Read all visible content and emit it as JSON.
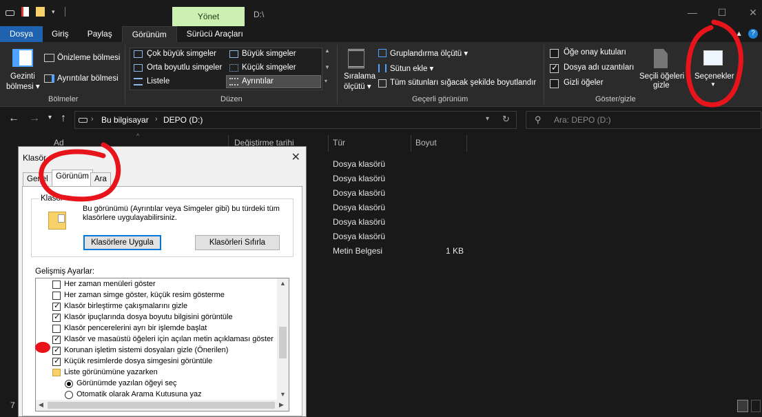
{
  "titlebar": {
    "context_tab": "Yönet",
    "window_title": "D:\\"
  },
  "ribbon_tabs": [
    "Dosya",
    "Giriş",
    "Paylaş",
    "Görünüm",
    "Sürücü Araçları"
  ],
  "ribbon": {
    "panes": {
      "navigation_pane": [
        "Gezinti",
        "bölmesi"
      ],
      "preview_pane": "Önizleme bölmesi",
      "details_pane": "Ayrıntılar bölmesi",
      "group": "Bölmeler"
    },
    "layout": {
      "items": [
        "Çok büyük simgeler",
        "Büyük simgeler",
        "Orta boyutlu simgeler",
        "Küçük simgeler",
        "Listele",
        "Ayrıntılar"
      ],
      "group": "Düzen"
    },
    "current_view": {
      "sort_by": [
        "Sıralama",
        "ölçütü"
      ],
      "group_by": "Gruplandırma ölçütü",
      "add_columns": "Sütun ekle",
      "size_columns": "Tüm sütunları sığacak şekilde boyutlandır",
      "group": "Geçerli görünüm"
    },
    "show_hide": {
      "item_checkboxes": {
        "label": "Öğe onay kutuları",
        "checked": false
      },
      "file_extensions": {
        "label": "Dosya adı uzantıları",
        "checked": true
      },
      "hidden_items": {
        "label": "Gizli öğeler",
        "checked": false
      },
      "hide_selected": [
        "Seçili öğeleri",
        "gizle"
      ],
      "options": "Seçenekler",
      "group": "Göster/gizle"
    }
  },
  "address": {
    "crumbs": [
      "Bu bilgisayar",
      "DEPO (D:)"
    ],
    "search_placeholder": "Ara: DEPO (D:)"
  },
  "filelist": {
    "columns": [
      "Ad",
      "Değiştirme tarihi",
      "Tür",
      "Boyut"
    ],
    "rows": [
      {
        "type": "Dosya klasörü",
        "size": ""
      },
      {
        "type": "Dosya klasörü",
        "size": ""
      },
      {
        "type": "Dosya klasörü",
        "size": ""
      },
      {
        "type": "Dosya klasörü",
        "size": ""
      },
      {
        "type": "Dosya klasörü",
        "size": ""
      },
      {
        "type": "Dosya klasörü",
        "size": ""
      },
      {
        "type": "Metin Belgesi",
        "size": "1 KB"
      }
    ]
  },
  "statusbar": {
    "count": "7"
  },
  "dialog": {
    "title": "Klasör",
    "tabs": [
      "Genel",
      "Görünüm",
      "Ara"
    ],
    "folder_views_label": "Klasör",
    "folder_views_desc": [
      "Bu görünümü (Ayrıntılar veya Simgeler gibi) bu türdeki tüm",
      "klasörlere uygulayabilirsiniz."
    ],
    "apply_button": "Klasörlere Uygula",
    "reset_button": "Klasörleri Sıfırla",
    "advanced_label": "Gelişmiş Ayarlar:",
    "settings": [
      {
        "label": "Her zaman menüleri göster",
        "kind": "check",
        "checked": false
      },
      {
        "label": "Her zaman simge göster, küçük resim gösterme",
        "kind": "check",
        "checked": false
      },
      {
        "label": "Klasör birleştirme çakışmalarını gizle",
        "kind": "check",
        "checked": true
      },
      {
        "label": "Klasör ipuçlarında dosya boyutu bilgisini görüntüle",
        "kind": "check",
        "checked": true
      },
      {
        "label": "Klasör pencerelerini ayrı bir işlemde başlat",
        "kind": "check",
        "checked": false
      },
      {
        "label": "Klasör ve masaüstü öğeleri için açılan metin açıklaması göster",
        "kind": "check",
        "checked": true
      },
      {
        "label": "Korunan işletim sistemi dosyaları gizle (Önerilen)",
        "kind": "check",
        "checked": true
      },
      {
        "label": "Küçük resimlerde dosya simgesini görüntüle",
        "kind": "check",
        "checked": true
      },
      {
        "label": "Liste görünümüne yazarken",
        "kind": "folder",
        "checked": false
      },
      {
        "label": "Görünümde yazılan öğeyi seç",
        "kind": "radio",
        "checked": true
      },
      {
        "label": "Otomatik olarak Arama Kutusuna yaz",
        "kind": "radio",
        "checked": false
      }
    ]
  },
  "colors": {
    "accent": "#1f63b0",
    "annotation": "#e8141b",
    "context_tab": "#ccefb2"
  }
}
